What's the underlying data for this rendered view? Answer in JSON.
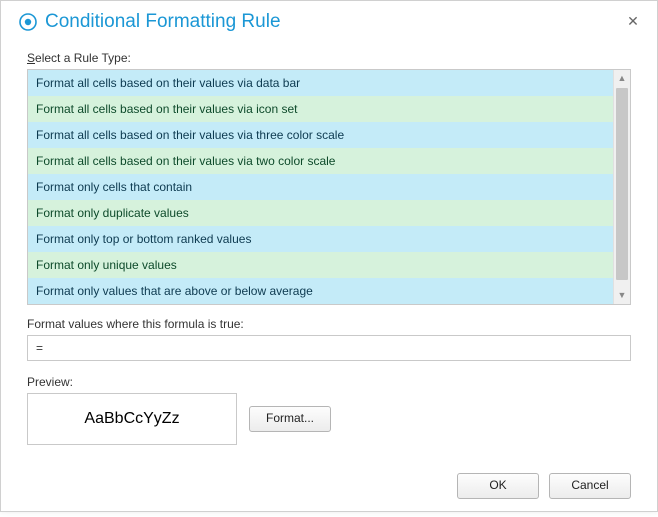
{
  "dialog": {
    "title": "Conditional Formatting Rule"
  },
  "rule_type": {
    "label": "Select a Rule Type:",
    "items": [
      "Format all cells based on their values via data bar",
      "Format all cells based on their values via icon set",
      "Format all cells based on their values via three color scale",
      "Format all cells based on their values via two color scale",
      "Format only cells that contain",
      "Format only duplicate values",
      "Format only top or bottom ranked values",
      "Format only unique values",
      "Format only values that are above or below average"
    ]
  },
  "formula": {
    "label": "Format values where this formula is true:",
    "value": "="
  },
  "preview": {
    "label": "Preview:",
    "sample": "AaBbCcYyZz",
    "format_button": "Format..."
  },
  "buttons": {
    "ok": "OK",
    "cancel": "Cancel"
  }
}
